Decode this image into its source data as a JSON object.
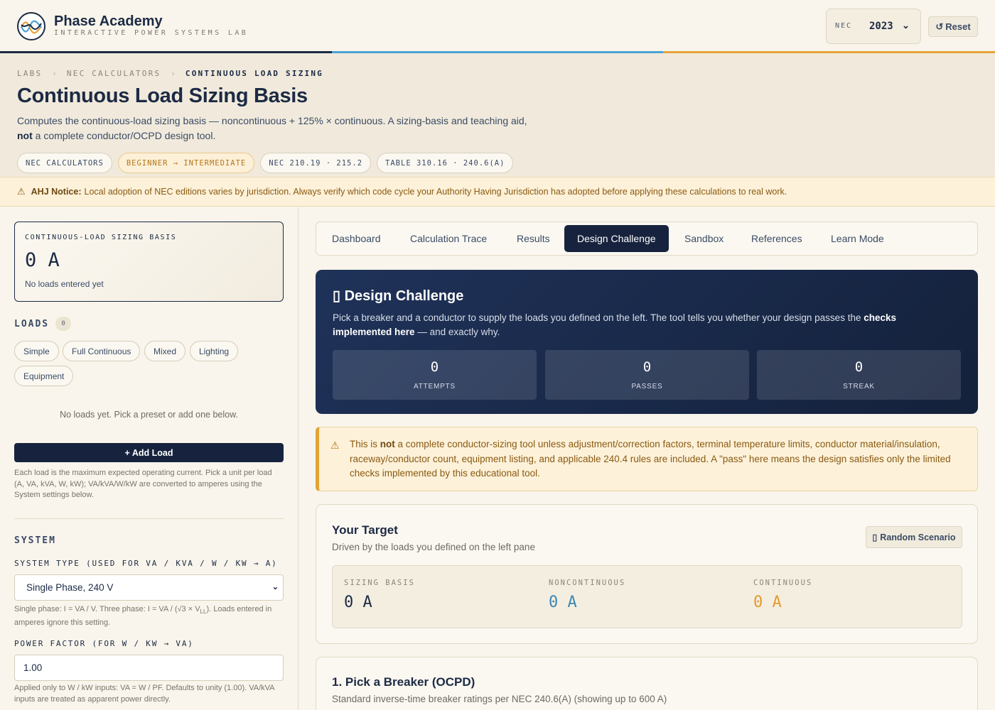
{
  "brand": {
    "name": "Phase Academy",
    "tagline": "INTERACTIVE POWER SYSTEMS LAB"
  },
  "header": {
    "nec_label": "NEC",
    "nec_edition": "2023",
    "reset_label": "Reset",
    "stripe_colors": [
      "#1c2a44",
      "#4aa3d4",
      "#e7a339"
    ]
  },
  "breadcrumb": [
    "LABS",
    "NEC CALCULATORS",
    "CONTINUOUS LOAD SIZING"
  ],
  "page": {
    "title": "Continuous Load Sizing Basis",
    "description_lead": "Computes the continuous-load sizing basis — noncontinuous + 125% × continuous. A sizing-basis and teaching aid,",
    "description_bold": "not",
    "description_tail": "a complete conductor/OCPD design tool.",
    "tags": [
      "NEC CALCULATORS",
      "BEGINNER → INTERMEDIATE",
      "NEC 210.19 · 215.2",
      "TABLE 310.16 · 240.6(A)"
    ]
  },
  "ahj": {
    "label": "AHJ Notice:",
    "text": "Local adoption of NEC editions varies by jurisdiction. Always verify which code cycle your Authority Having Jurisdiction has adopted before applying these calculations to real work."
  },
  "left": {
    "basis_label": "CONTINUOUS-LOAD SIZING BASIS",
    "basis_value": "0 A",
    "basis_note": "No loads entered yet",
    "loads_title": "LOADS",
    "loads_count": "0",
    "presets": [
      "Simple",
      "Full Continuous",
      "Mixed",
      "Lighting",
      "Equipment"
    ],
    "empty_note": "No loads yet. Pick a preset or add one below.",
    "add_button": "+ Add Load",
    "loads_help": "Each load is the maximum expected operating current. Pick a unit per load (A, VA, kVA, W, kW); VA/kVA/W/kW are converted to amperes using the System settings below.",
    "system_title": "SYSTEM",
    "system_type_label": "SYSTEM TYPE (USED FOR VA / KVA / W / KW → A)",
    "system_type_value": "Single Phase, 240 V",
    "system_help_a": "Single phase: I = VA / V. Three phase: I = VA / (√3 × V",
    "system_help_sub": "LL",
    "system_help_b": "). Loads entered in amperes ignore this setting.",
    "pf_label": "POWER FACTOR (FOR W / KW → VA)",
    "pf_value": "1.00",
    "pf_help": "Applied only to W / kW inputs: VA = W / PF. Defaults to unity (1.00). VA/kVA inputs are treated as apparent power directly."
  },
  "tabs": [
    "Dashboard",
    "Calculation Trace",
    "Results",
    "Design Challenge",
    "Sandbox",
    "References",
    "Learn Mode"
  ],
  "active_tab": "Design Challenge",
  "challenge": {
    "title": "Design Challenge",
    "desc_lead": "Pick a breaker and a conductor to supply the loads you defined on the left. The tool tells you whether your design passes the",
    "desc_bold": "checks implemented here",
    "desc_tail": "— and exactly why.",
    "stats": [
      {
        "value": "0",
        "label": "ATTEMPTS"
      },
      {
        "value": "0",
        "label": "PASSES"
      },
      {
        "value": "0",
        "label": "STREAK"
      }
    ]
  },
  "disclaimer": {
    "lead": "This is",
    "bold": "not",
    "tail": "a complete conductor-sizing tool unless adjustment/correction factors, terminal temperature limits, conductor material/insulation, raceway/conductor count, equipment listing, and applicable 240.4 rules are included. A \"pass\" here means the design satisfies only the limited checks implemented by this educational tool."
  },
  "target": {
    "title": "Your Target",
    "subtitle": "Driven by the loads you defined on the left pane",
    "random_button": "Random Scenario",
    "cols": [
      {
        "label": "SIZING BASIS",
        "value": "0 A",
        "color": "#1c2a44"
      },
      {
        "label": "NONCONTINUOUS",
        "value": "0 A",
        "color": "#3a87b3"
      },
      {
        "label": "CONTINUOUS",
        "value": "0 A",
        "color": "#e39a2c"
      }
    ]
  },
  "breaker": {
    "title": "1. Pick a Breaker (OCPD)",
    "subtitle": "Standard inverse-time breaker ratings per NEC 240.6(A) (showing up to 600 A)"
  }
}
